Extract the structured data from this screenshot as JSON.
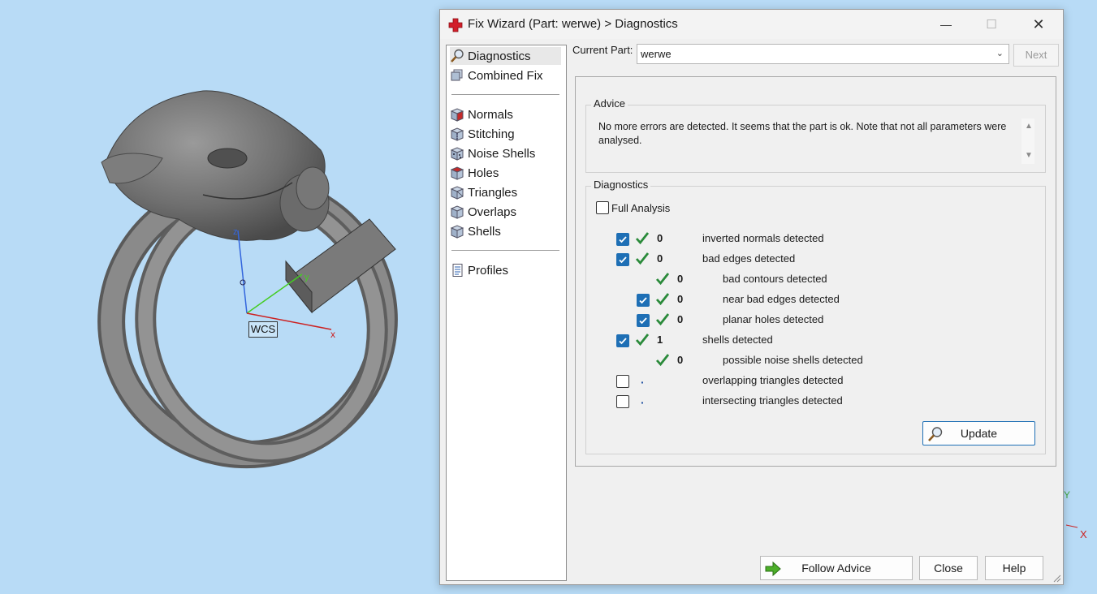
{
  "viewport": {
    "wcs_label": "WCS",
    "axis_x": "x",
    "axis_y": "y",
    "axis_z": "z",
    "corner_axis_y": "Y",
    "corner_axis_x": "X"
  },
  "window": {
    "title": "Fix Wizard (Part: werwe) > Diagnostics",
    "icon": "red-cross-icon",
    "minimize_glyph": "—",
    "maximize_glyph": "☐",
    "close_glyph": "✕"
  },
  "nav": {
    "items": [
      {
        "label": "Diagnostics",
        "icon": "magnifier-icon",
        "selected": true
      },
      {
        "label": "Combined Fix",
        "icon": "combined-fix-icon"
      },
      {
        "label": "Normals",
        "icon": "normals-cube-icon"
      },
      {
        "label": "Stitching",
        "icon": "stitching-cube-icon"
      },
      {
        "label": "Noise Shells",
        "icon": "noise-shells-cube-icon"
      },
      {
        "label": "Holes",
        "icon": "holes-cube-icon"
      },
      {
        "label": "Triangles",
        "icon": "triangles-cube-icon"
      },
      {
        "label": "Overlaps",
        "icon": "overlaps-cube-icon"
      },
      {
        "label": "Shells",
        "icon": "shells-cube-icon"
      },
      {
        "label": "Profiles",
        "icon": "profiles-document-icon"
      }
    ]
  },
  "current_part": {
    "label": "Current Part:",
    "value": "werwe",
    "next_label": "Next"
  },
  "advice": {
    "title": "Advice",
    "text": "No more errors are detected. It seems that the part is ok. Note that not all parameters were analysed."
  },
  "diagnostics": {
    "title": "Diagnostics",
    "full_analysis_label": "Full Analysis",
    "full_analysis_checked": false,
    "rows": [
      {
        "label": "inverted normals detected",
        "count": "0",
        "checked": true,
        "status": "ok"
      },
      {
        "label": "bad edges detected",
        "count": "0",
        "checked": true,
        "status": "ok"
      },
      {
        "label": "bad contours detected",
        "count": "0",
        "checked": null,
        "status": "ok"
      },
      {
        "label": "near bad edges detected",
        "count": "0",
        "checked": true,
        "status": "ok"
      },
      {
        "label": "planar holes detected",
        "count": "0",
        "checked": true,
        "status": "ok"
      },
      {
        "label": "shells detected",
        "count": "1",
        "checked": true,
        "status": "ok"
      },
      {
        "label": "possible noise shells detected",
        "count": "0",
        "checked": null,
        "status": "ok"
      },
      {
        "label": "overlapping triangles detected",
        "count": "",
        "checked": false,
        "status": "dot"
      },
      {
        "label": "intersecting triangles detected",
        "count": "",
        "checked": false,
        "status": "dot"
      }
    ],
    "update_label": "Update"
  },
  "footer": {
    "follow_advice_label": "Follow Advice",
    "close_label": "Close",
    "help_label": "Help"
  },
  "colors": {
    "background": "#b8dbf6",
    "accent": "#1e6fb5",
    "tick_green": "#2a8a3a",
    "axis_red": "#cc2222",
    "axis_green": "#44cc22",
    "axis_blue": "#3366dd"
  }
}
